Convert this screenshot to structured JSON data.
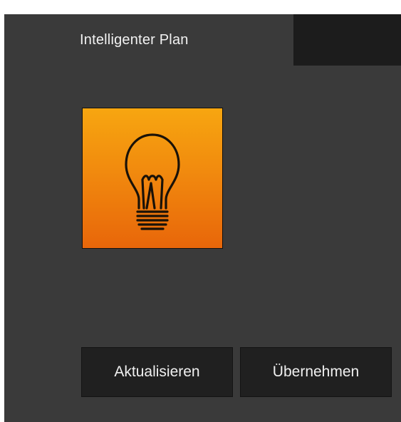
{
  "tabs": [
    {
      "label": "Intelligenter Plan",
      "active": true
    }
  ],
  "tile": {
    "icon": "lightbulb-icon",
    "gradient_top": "#f7a610",
    "gradient_bottom": "#e8660a"
  },
  "buttons": {
    "refresh_label": "Aktualisieren",
    "apply_label": "Übernehmen"
  },
  "colors": {
    "panel_bg": "#3a3a3a",
    "tab_strip_bg": "#1c1c1c",
    "button_bg": "#202020",
    "text": "#f2f2f2"
  }
}
